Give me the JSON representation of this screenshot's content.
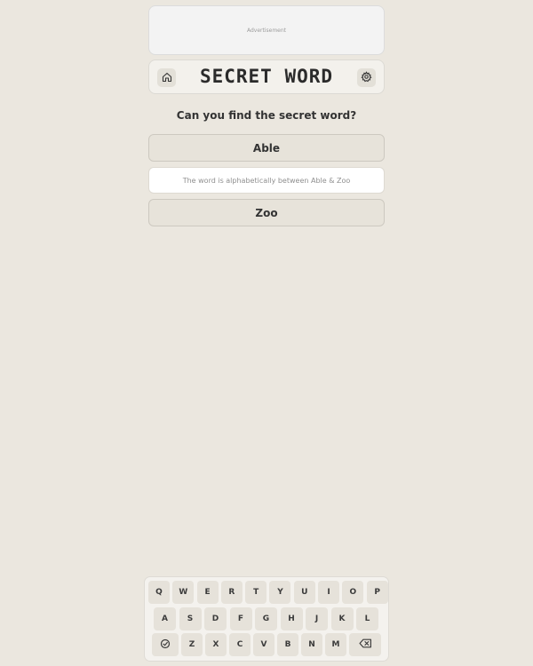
{
  "ad": {
    "label": "Advertisement"
  },
  "header": {
    "title": "SECRET WORD"
  },
  "game": {
    "question": "Can you find the secret word?",
    "upper_bound": "Able",
    "hint": "The word is alphabetically between Able & Zoo",
    "lower_bound": "Zoo"
  },
  "keyboard": {
    "row1": [
      "Q",
      "W",
      "E",
      "R",
      "T",
      "Y",
      "U",
      "I",
      "O",
      "P"
    ],
    "row2": [
      "A",
      "S",
      "D",
      "F",
      "G",
      "H",
      "J",
      "K",
      "L"
    ],
    "row3": [
      "Z",
      "X",
      "C",
      "V",
      "B",
      "N",
      "M"
    ]
  },
  "icons": {
    "home": "home-icon",
    "settings": "gear-icon",
    "enter": "check-circle-icon",
    "backspace": "backspace-icon"
  }
}
